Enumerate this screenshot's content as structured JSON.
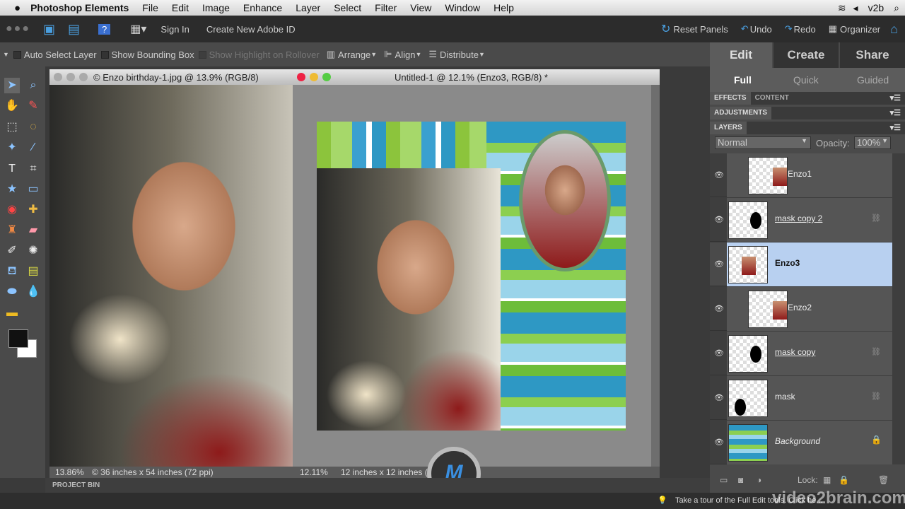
{
  "menubar": {
    "app": "Photoshop Elements",
    "items": [
      "File",
      "Edit",
      "Image",
      "Enhance",
      "Layer",
      "Select",
      "Filter",
      "View",
      "Window",
      "Help"
    ],
    "user": "v2b"
  },
  "appbar": {
    "sign_in": "Sign In",
    "create_id": "Create New Adobe ID",
    "reset": "Reset Panels",
    "undo": "Undo",
    "redo": "Redo",
    "organizer": "Organizer"
  },
  "options": {
    "auto_select": "Auto Select Layer",
    "bounding": "Show Bounding Box",
    "highlight": "Show Highlight on Rollover",
    "arrange": "Arrange",
    "align": "Align",
    "distribute": "Distribute"
  },
  "docs": [
    {
      "title": "© Enzo birthday-1.jpg @ 13.9% (RGB/8)",
      "zoom": "13.86%",
      "info": "© 36 inches x 54 inches (72 ppi)"
    },
    {
      "title": "Untitled-1 @ 12.1% (Enzo3, RGB/8) *",
      "zoom": "12.11%",
      "info": "12 inches x 12 inches (3"
    }
  ],
  "panel": {
    "tabs": [
      "Edit",
      "Create",
      "Share"
    ],
    "subtabs": [
      "Full",
      "Quick",
      "Guided"
    ],
    "effects": "EFFECTS",
    "content": "CONTENT",
    "adjustments": "ADJUSTMENTS",
    "layers": "LAYERS",
    "blend": "Normal",
    "opacity_label": "Opacity:",
    "opacity": "100%",
    "lock": "Lock:"
  },
  "layers": [
    {
      "name": "Enzo1",
      "selected": false
    },
    {
      "name": "mask copy 2",
      "selected": false
    },
    {
      "name": "Enzo3",
      "selected": true
    },
    {
      "name": "Enzo2",
      "selected": false
    },
    {
      "name": "mask copy",
      "selected": false
    },
    {
      "name": "mask",
      "selected": false
    },
    {
      "name": "Background",
      "selected": false
    }
  ],
  "bin": "PROJECT BIN",
  "tip": "Take a tour of the Full Edit tools. Click he...",
  "watermark": "video2brain.com",
  "colors": {
    "selected_layer": "#b8d0f0",
    "accent": "#4a9fe0"
  }
}
